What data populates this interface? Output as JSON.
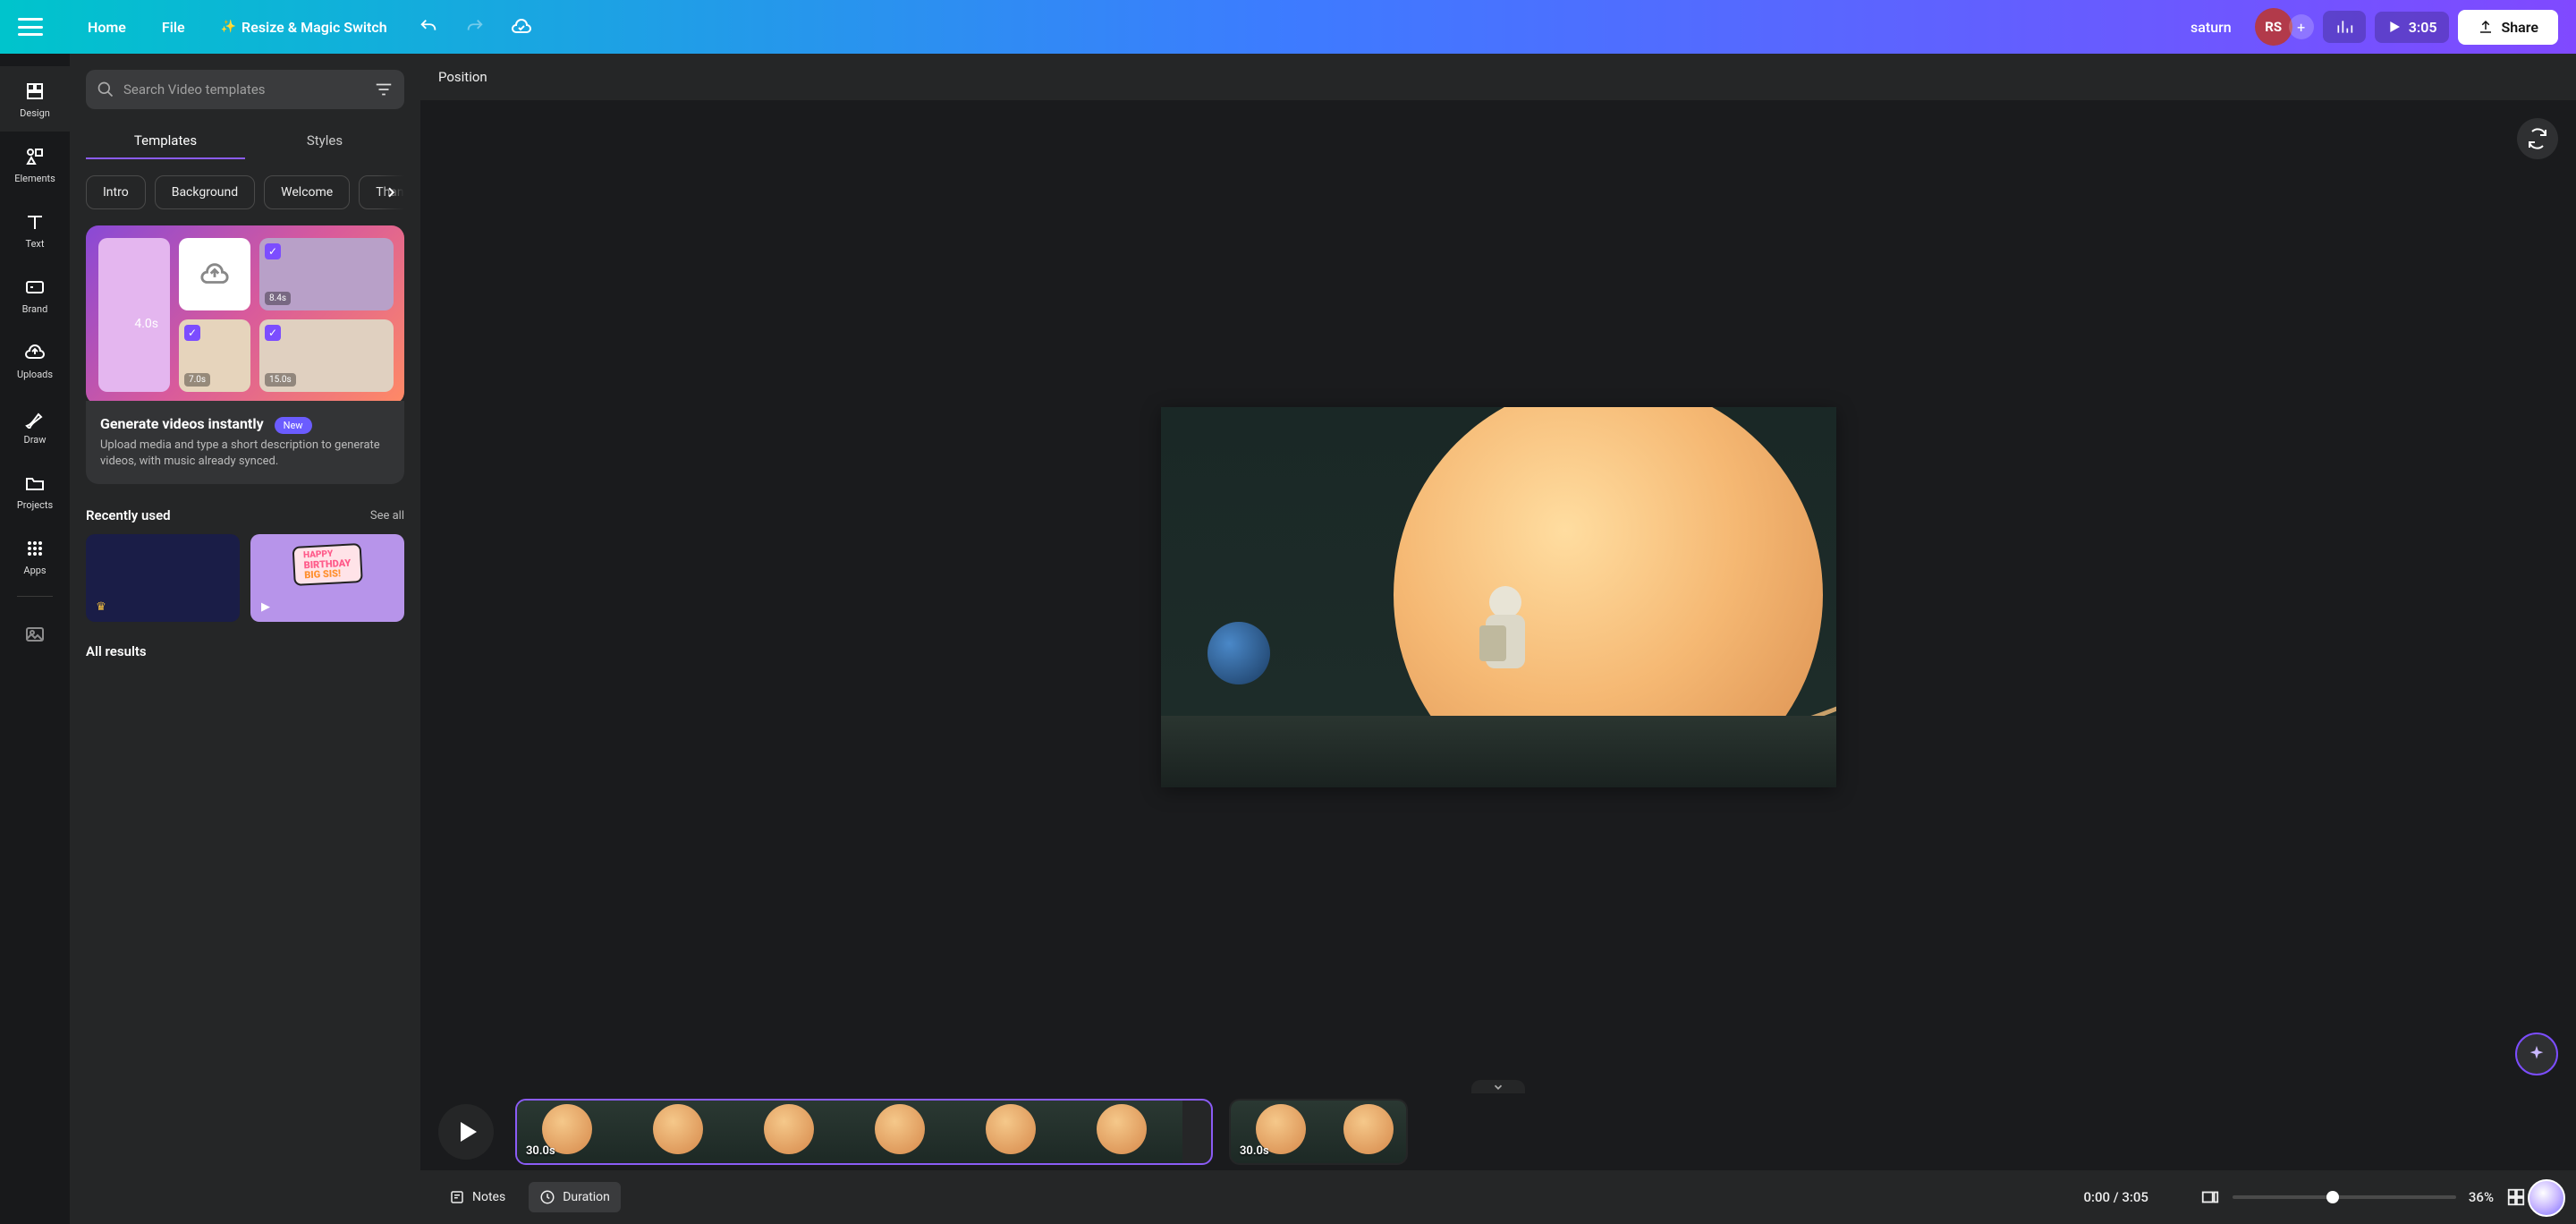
{
  "top": {
    "home": "Home",
    "file": "File",
    "resize": "Resize & Magic Switch",
    "doc_title": "saturn",
    "avatar_initials": "RS",
    "duration": "3:05",
    "share": "Share"
  },
  "rail": {
    "design": "Design",
    "elements": "Elements",
    "text": "Text",
    "brand": "Brand",
    "uploads": "Uploads",
    "draw": "Draw",
    "projects": "Projects",
    "apps": "Apps"
  },
  "panel": {
    "search_placeholder": "Search Video templates",
    "tab_templates": "Templates",
    "tab_styles": "Styles",
    "chips": {
      "intro": "Intro",
      "background": "Background",
      "welcome": "Welcome",
      "thanks": "Thanks"
    },
    "promo": {
      "big_dur": "4.0s",
      "tile_b_dur": "8.4s",
      "tile_c_dur": "7.0s",
      "tile_d_dur": "15.0s",
      "title": "Generate videos instantly",
      "badge": "New",
      "desc": "Upload media and type a short description to generate videos, with music already synced."
    },
    "recent_title": "Recently used",
    "see_all": "See all",
    "thumb2_line1": "HAPPY",
    "thumb2_line2": "BIRTHDAY",
    "thumb2_line3": "BIG SIS!",
    "all_results": "All results"
  },
  "context": {
    "position": "Position"
  },
  "timeline": {
    "clip1_dur": "30.0s",
    "clip2_dur": "30.0s"
  },
  "bottom": {
    "notes": "Notes",
    "duration": "Duration",
    "time": "0:00 / 3:05",
    "zoom": "36%"
  }
}
